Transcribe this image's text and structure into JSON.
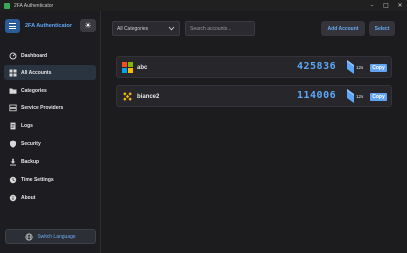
{
  "window": {
    "title": "2FA Authenticator",
    "controls": {
      "minimize": "–",
      "maximize": "□",
      "close": "✕"
    }
  },
  "header": {
    "title": "2FA Authenticator",
    "theme_icon": "sun-icon"
  },
  "sidebar": {
    "items": [
      {
        "label": "Dashboard",
        "icon": "dashboard-icon",
        "active": false
      },
      {
        "label": "All Accounts",
        "icon": "grid-icon",
        "active": true
      },
      {
        "label": "Categories",
        "icon": "folder-icon",
        "active": false
      },
      {
        "label": "Service Providers",
        "icon": "server-icon",
        "active": false
      },
      {
        "label": "Logs",
        "icon": "document-icon",
        "active": false
      },
      {
        "label": "Security",
        "icon": "shield-icon",
        "active": false
      },
      {
        "label": "Backup",
        "icon": "download-icon",
        "active": false
      },
      {
        "label": "Time Settings",
        "icon": "clock-icon",
        "active": false
      },
      {
        "label": "About",
        "icon": "info-icon",
        "active": false
      }
    ],
    "switch_language": {
      "label": "Switch Language",
      "icon": "globe-icon"
    }
  },
  "toolbar": {
    "category_select": {
      "selected": "All Categories"
    },
    "search": {
      "placeholder": "Search accounts...",
      "value": ""
    },
    "add_account_label": "Add Account",
    "select_label": "Select"
  },
  "accounts": [
    {
      "name": "abc",
      "icon": "microsoft-icon",
      "code": "425836",
      "timer": "12s",
      "copy_label": "Copy"
    },
    {
      "name": "biance2",
      "icon": "binance-icon",
      "code": "114006",
      "timer": "12s",
      "copy_label": "Copy"
    }
  ],
  "colors": {
    "accent": "#5ea7f7",
    "button_primary": "#2a5d98",
    "background": "#1c1c1f",
    "card": "#26262b",
    "copy_button": "#62a4f2",
    "binance": "#f0b90b"
  }
}
